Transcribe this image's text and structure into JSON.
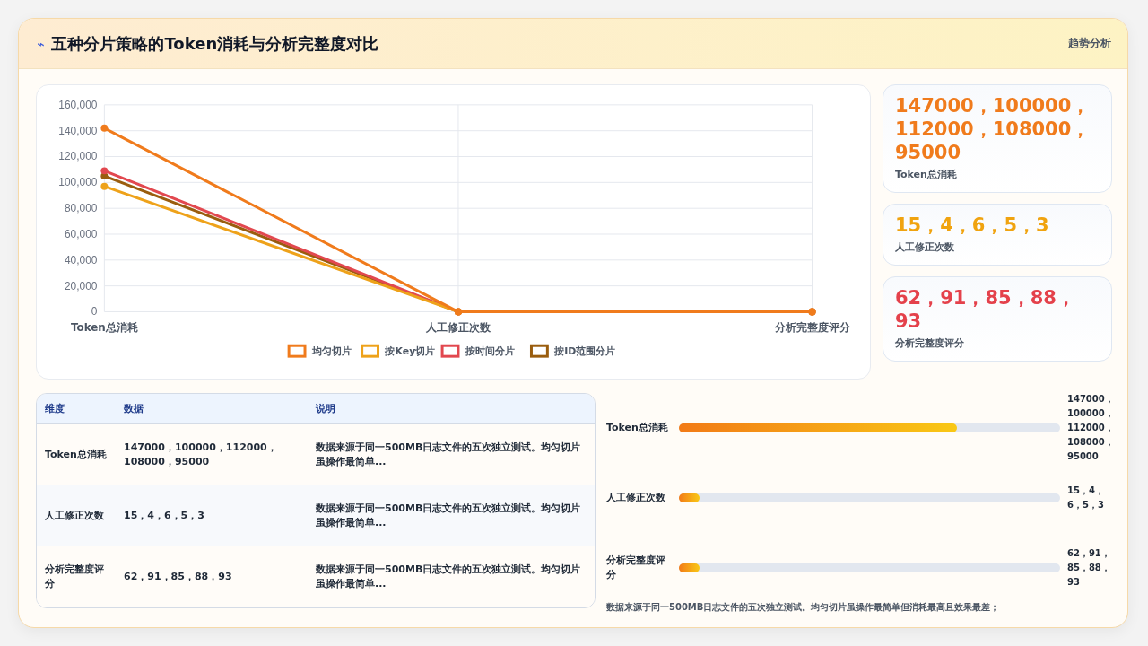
{
  "header": {
    "icon": "⌁",
    "title": "五种分片策略的Token消耗与分析完整度对比",
    "link": "趋势分析"
  },
  "chart": {
    "chart_data": {
      "type": "line",
      "grid": true,
      "legend": "bottom",
      "categories": [
        "Token总消耗",
        "人工修正次数",
        "分析完整度评分"
      ],
      "ylim": [
        0,
        160000
      ],
      "yticks": [
        {
          "value": 0,
          "label": "0"
        },
        {
          "value": 20000,
          "label": "20,000"
        },
        {
          "value": 40000,
          "label": "40,000"
        },
        {
          "value": 60000,
          "label": "60,000"
        },
        {
          "value": 80000,
          "label": "80,000"
        },
        {
          "value": 100000,
          "label": "100,000"
        },
        {
          "value": 120000,
          "label": "120,000"
        },
        {
          "value": 140000,
          "label": "140,000"
        },
        {
          "value": 160000,
          "label": "160,000"
        }
      ],
      "series": [
        {
          "name": "均匀切片",
          "color": "#f07b1c",
          "marker": "circle",
          "values": [
            142000,
            0,
            0
          ]
        },
        {
          "name": "按Key切片",
          "color": "#eea21a",
          "marker": "circle",
          "values": [
            97000,
            0,
            0
          ]
        },
        {
          "name": "按时间分片",
          "color": "#e2484f",
          "marker": "circle",
          "values": [
            109000,
            0,
            0
          ]
        },
        {
          "name": "按ID范围分片",
          "color": "#9a5d0e",
          "marker": "circle",
          "values": [
            105000,
            0,
            0
          ]
        }
      ]
    }
  },
  "stats": [
    {
      "value": "147000，100000，112000，108000，95000",
      "label": "Token总消耗",
      "color": "#f07b1c"
    },
    {
      "value": "15，4，6，5，3",
      "label": "人工修正次数",
      "color": "#f0a30f"
    },
    {
      "value": "62，91，85，88，93",
      "label": "分析完整度评分",
      "color": "#e4414b"
    }
  ],
  "table": {
    "columns": [
      "维度",
      "数据",
      "说明"
    ],
    "rows": [
      [
        "Token总消耗",
        "147000，100000，112000，108000，95000",
        "数据来源于同一500MB日志文件的五次独立测试。均匀切片虽操作最简单..."
      ],
      [
        "人工修正次数",
        "15，4，6，5，3",
        "数据来源于同一500MB日志文件的五次独立测试。均匀切片虽操作最简单..."
      ],
      [
        "分析完整度评分",
        "62，91，85，88，93",
        "数据来源于同一500MB日志文件的五次独立测试。均匀切片虽操作最简单..."
      ]
    ]
  },
  "bars": [
    {
      "label": "Token总消耗",
      "level": 0.73,
      "value": "147000，100000，112000，108000，95000"
    },
    {
      "label": "人工修正次数",
      "level": 0.055,
      "value": "15，4，6，5，3"
    },
    {
      "label": "分析完整度评分",
      "level": 0.055,
      "value": "62，91，85，88，93"
    }
  ],
  "note": "数据来源于同一500MB日志文件的五次独立测试。均匀切片虽操作最简单但消耗最高且效果最差；"
}
